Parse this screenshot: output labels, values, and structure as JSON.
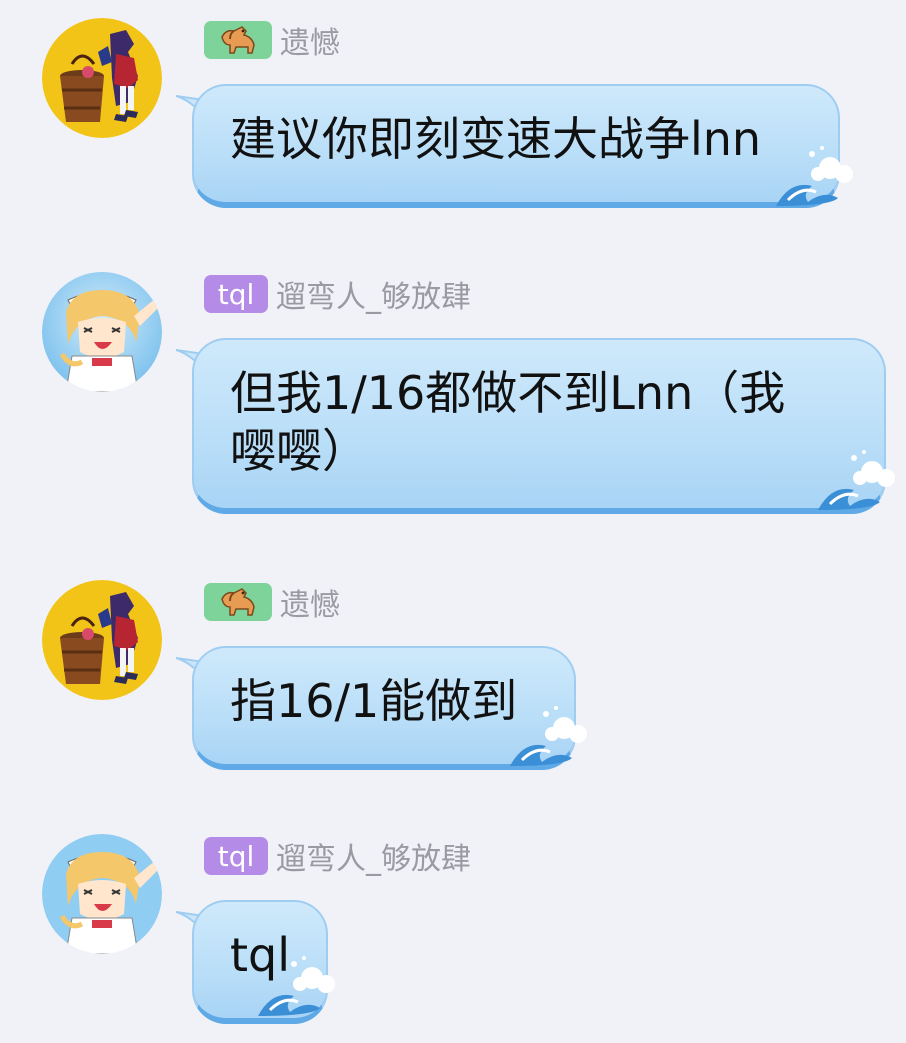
{
  "messages": [
    {
      "badge": "horse",
      "badge_icon": "horse-icon",
      "nickname": "遗憾",
      "text": "建议你即刻变速大战争lnn",
      "avatar": "avatar-girl-with-bucket"
    },
    {
      "badge": "tql",
      "nickname": "遛弯人_够放肆",
      "text_line1": "但我1/16都做不到Lnn（我",
      "text_line2": "嘤嘤）",
      "avatar": "avatar-maid-anime"
    },
    {
      "badge": "horse",
      "badge_icon": "horse-icon",
      "nickname": "遗憾",
      "text": "指16/1能做到",
      "avatar": "avatar-girl-with-bucket"
    },
    {
      "badge": "tql",
      "nickname": "遛弯人_够放肆",
      "text": "tql",
      "avatar": "avatar-maid-anime"
    }
  ],
  "colors": {
    "background": "#f1f2f7",
    "bubble": "#bfe1f9",
    "bubble_border": "#5fa9e6",
    "badge_horse": "#7dd39a",
    "badge_tql": "#b48be6",
    "nickname": "#9a9aa3"
  }
}
